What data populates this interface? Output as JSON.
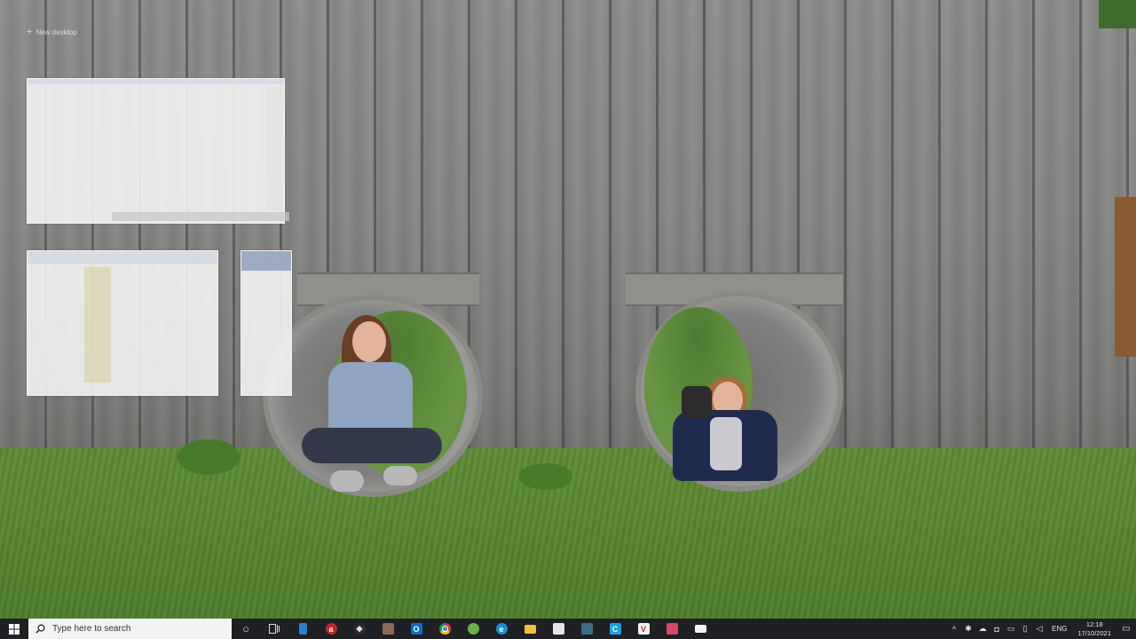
{
  "desktop": {
    "new_desktop_label": "New desktop"
  },
  "taskbar": {
    "search_placeholder": "Type here to search",
    "apps": [
      {
        "name": "cortana-icon",
        "glyph": "○"
      },
      {
        "name": "task-view-icon",
        "glyph": "⧉"
      },
      {
        "name": "file-icon",
        "glyph": ""
      },
      {
        "name": "app-red-icon",
        "glyph": "a"
      },
      {
        "name": "inkscape-icon",
        "glyph": "◆"
      },
      {
        "name": "app-photo-icon",
        "glyph": ""
      },
      {
        "name": "outlook-icon",
        "glyph": "O"
      },
      {
        "name": "chrome-icon",
        "glyph": ""
      },
      {
        "name": "app-active-icon",
        "glyph": ""
      },
      {
        "name": "edge-icon",
        "glyph": "e"
      },
      {
        "name": "file-explorer-icon",
        "glyph": ""
      },
      {
        "name": "store-icon",
        "glyph": ""
      },
      {
        "name": "app-grid-icon",
        "glyph": ""
      },
      {
        "name": "app-c-icon",
        "glyph": "C"
      },
      {
        "name": "app-v-icon",
        "glyph": "V"
      },
      {
        "name": "app-stack-icon",
        "glyph": ""
      },
      {
        "name": "app-window-icon",
        "glyph": ""
      }
    ],
    "language": "ENG",
    "time": "12:18",
    "date": "17/10/2021"
  },
  "colors": {
    "taskbar": "#1f2023",
    "search_box": "#f3f3f3",
    "grass": "#5a8732",
    "fence": "#858583"
  }
}
